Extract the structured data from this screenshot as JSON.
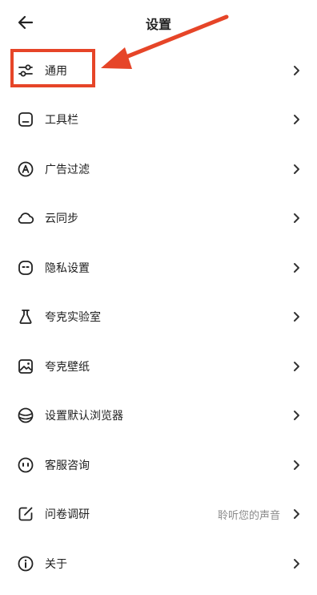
{
  "header": {
    "title": "设置"
  },
  "icons": {
    "back": "arrow-left-icon",
    "chevron": "chevron-right-icon"
  },
  "accent_color": "#e64528",
  "items": [
    {
      "label": "通用",
      "icon": "sliders-icon"
    },
    {
      "label": "工具栏",
      "icon": "toolbar-icon"
    },
    {
      "label": "广告过滤",
      "icon": "ad-block-icon"
    },
    {
      "label": "云同步",
      "icon": "cloud-icon"
    },
    {
      "label": "隐私设置",
      "icon": "privacy-icon"
    },
    {
      "label": "夸克实验室",
      "icon": "flask-icon"
    },
    {
      "label": "夸克壁纸",
      "icon": "wallpaper-icon"
    },
    {
      "label": "设置默认浏览器",
      "icon": "browser-icon"
    },
    {
      "label": "客服咨询",
      "icon": "support-icon"
    },
    {
      "label": "问卷调研",
      "icon": "survey-icon",
      "sub": "聆听您的声音"
    },
    {
      "label": "关于",
      "icon": "info-icon"
    }
  ]
}
